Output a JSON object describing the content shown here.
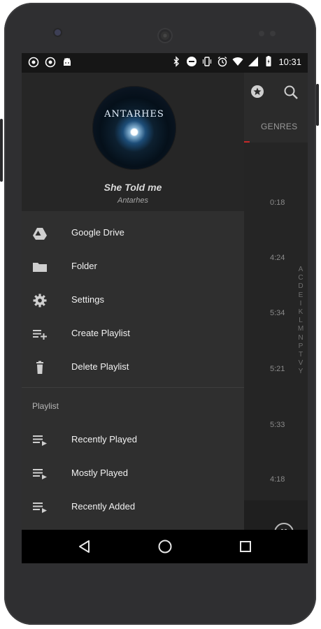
{
  "status_bar": {
    "time": "10:31",
    "left_icons": [
      "notification-app-icon",
      "notification-app-icon",
      "android-icon"
    ],
    "right_icons": [
      "bluetooth-icon",
      "do-not-disturb-icon",
      "vibrate-icon",
      "alarm-icon",
      "wifi-icon",
      "signal-icon",
      "battery-icon"
    ]
  },
  "drawer": {
    "album_art_text": "ANTARHES",
    "now_playing": {
      "title": "She Told me",
      "artist": "Antarhes"
    },
    "menu": [
      {
        "label": "Google Drive",
        "icon": "google-drive-icon"
      },
      {
        "label": "Folder",
        "icon": "folder-icon"
      },
      {
        "label": "Settings",
        "icon": "gear-icon"
      },
      {
        "label": "Create Playlist",
        "icon": "playlist-add-icon"
      },
      {
        "label": "Delete Playlist",
        "icon": "trash-icon"
      }
    ],
    "playlist_section_label": "Playlist",
    "playlists": [
      {
        "label": "Recently Played",
        "icon": "playlist-play-icon"
      },
      {
        "label": "Mostly Played",
        "icon": "playlist-play-icon"
      },
      {
        "label": "Recently Added",
        "icon": "playlist-play-icon"
      }
    ]
  },
  "background_app": {
    "tab_label": "GENRES",
    "durations": [
      "0:18",
      "4:24",
      "5:34",
      "5:21",
      "5:33",
      "4:18"
    ],
    "alphabet_index": "A C D E I K L M N P T V Y",
    "toolbar_icons": [
      "star-icon",
      "search-icon"
    ],
    "player_icon": "pause-icon"
  },
  "nav_bar": {
    "icons": [
      "back-icon",
      "home-icon",
      "recents-icon"
    ]
  }
}
